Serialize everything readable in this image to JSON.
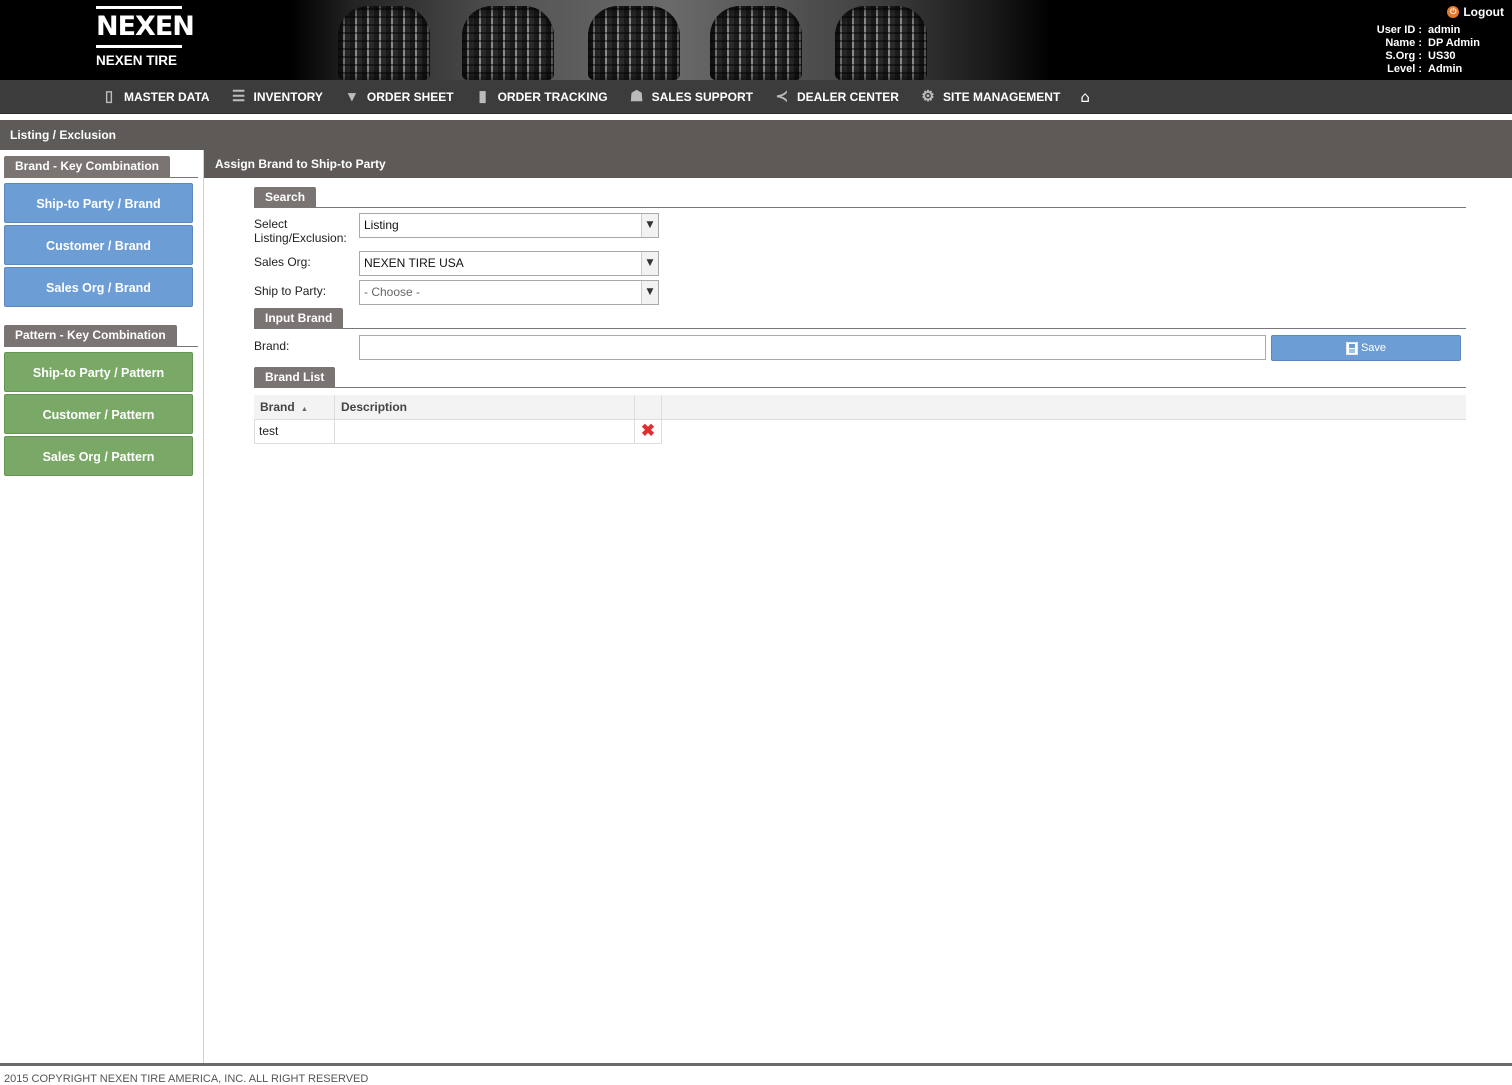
{
  "header": {
    "logo_mark": "NEXEN",
    "logo_text": "NEXEN TIRE",
    "logout_label": "Logout",
    "user": [
      {
        "key": "User ID :",
        "value": "admin"
      },
      {
        "key": "Name :",
        "value": "DP Admin"
      },
      {
        "key": "S.Org :",
        "value": "US30"
      },
      {
        "key": "Level :",
        "value": "Admin"
      }
    ]
  },
  "nav": [
    {
      "label": "MASTER DATA",
      "icon": "book-icon"
    },
    {
      "label": "INVENTORY",
      "icon": "stack-icon"
    },
    {
      "label": "ORDER SHEET",
      "icon": "basket-icon"
    },
    {
      "label": "ORDER TRACKING",
      "icon": "document-icon"
    },
    {
      "label": "SALES SUPPORT",
      "icon": "people-icon"
    },
    {
      "label": "DEALER CENTER",
      "icon": "share-icon"
    },
    {
      "label": "SITE MANAGEMENT",
      "icon": "gear-icon"
    }
  ],
  "breadcrumb": "Listing / Exclusion",
  "sidebar": {
    "brand_section": "Brand - Key Combination",
    "brand_buttons": [
      "Ship-to Party / Brand",
      "Customer / Brand",
      "Sales Org / Brand"
    ],
    "pattern_section": "Pattern - Key Combination",
    "pattern_buttons": [
      "Ship-to Party / Pattern",
      "Customer / Pattern",
      "Sales Org / Pattern"
    ]
  },
  "main": {
    "title": "Assign Brand to Ship-to Party",
    "search_tab": "Search",
    "listing_label_1": "Select",
    "listing_label_2": "Listing/Exclusion:",
    "listing_value": "Listing",
    "sales_org_label": "Sales Org:",
    "sales_org_value": "NEXEN TIRE USA",
    "ship_to_label": "Ship to Party:",
    "ship_to_placeholder": "- Choose -",
    "input_tab": "Input Brand",
    "brand_label": "Brand:",
    "brand_value": "",
    "save_label": "Save",
    "list_tab": "Brand List",
    "columns": [
      "Brand",
      "Description"
    ],
    "sort_indicator": "▲",
    "rows": [
      {
        "brand": "test",
        "description": ""
      }
    ]
  },
  "footer": "2015 COPYRIGHT NEXEN TIRE AMERICA, INC. ALL RIGHT RESERVED",
  "colors": {
    "brand_button": "#6c9dd4",
    "pattern_button": "#7aa967",
    "section_tab": "#7a7573",
    "header_bar": "#5e5a58"
  }
}
